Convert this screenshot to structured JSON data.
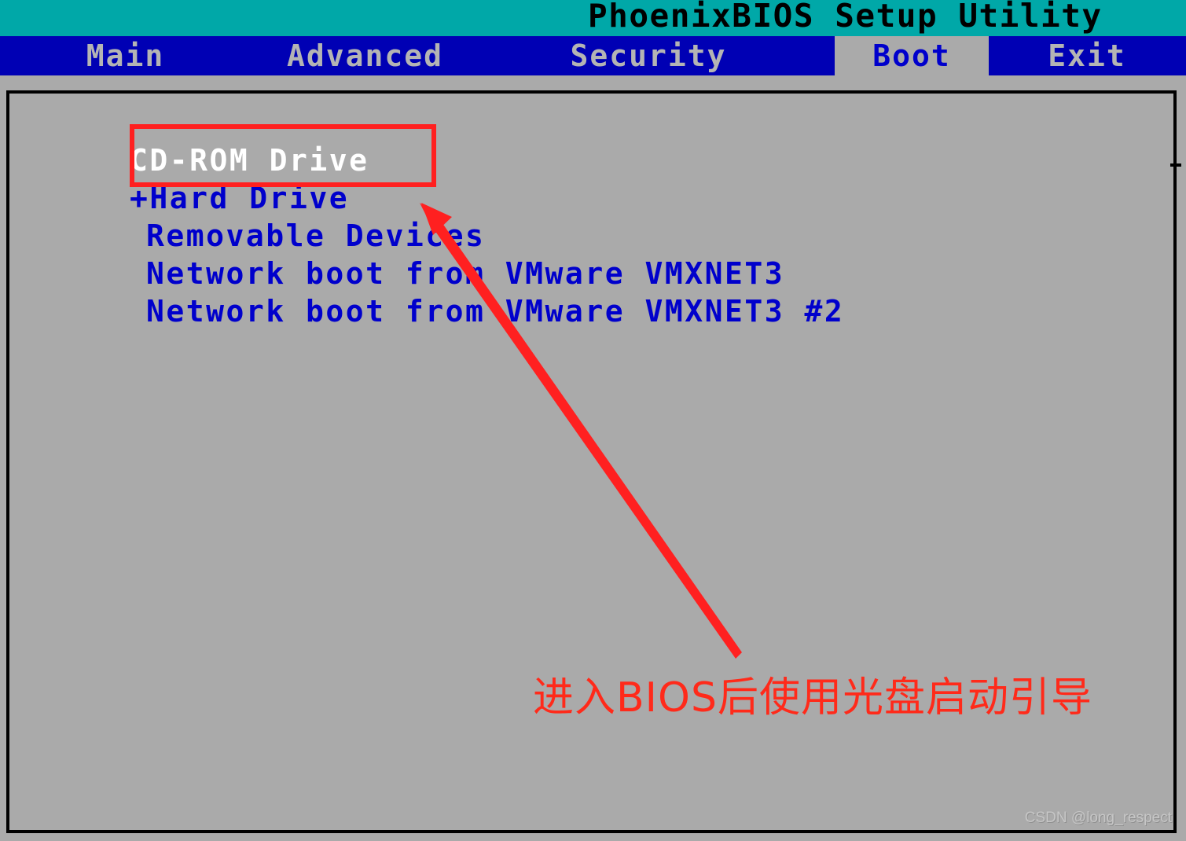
{
  "header": {
    "title": "PhoenixBIOS Setup Utility",
    "bg_color": "#00a8a8",
    "text_color": "#000000"
  },
  "menu": {
    "bg_color": "#0000b4",
    "text_color": "#b4b4b4",
    "active_bg_color": "#aaaaaa",
    "active_text_color": "#0000cc",
    "items": [
      {
        "label": "Main",
        "active": false
      },
      {
        "label": "Advanced",
        "active": false
      },
      {
        "label": "Security",
        "active": false
      },
      {
        "label": "Boot",
        "active": true
      },
      {
        "label": "Exit",
        "active": false
      }
    ]
  },
  "boot": {
    "panel_bg_color": "#aaaaaa",
    "item_color": "#0000cc",
    "selected_color": "#ffffff",
    "items": [
      {
        "label": "CD-ROM Drive",
        "prefix": " ",
        "selected": true
      },
      {
        "label": "Hard Drive",
        "prefix": "+",
        "selected": false
      },
      {
        "label": "Removable Devices",
        "prefix": " ",
        "selected": false
      },
      {
        "label": "Network boot from VMware VMXNET3",
        "prefix": " ",
        "selected": false
      },
      {
        "label": "Network boot from VMware VMXNET3 #2",
        "prefix": " ",
        "selected": false
      }
    ]
  },
  "annotation": {
    "caption": "进入BIOS后使用光盘启动引导",
    "color": "#ff2a1a",
    "box_color": "#ff2020",
    "box_target": "CD-ROM Drive",
    "arrow_from": "进入BIOS后使用光盘启动引导",
    "arrow_to": "CD-ROM Drive"
  },
  "watermark": {
    "text": "CSDN @long_respect"
  }
}
